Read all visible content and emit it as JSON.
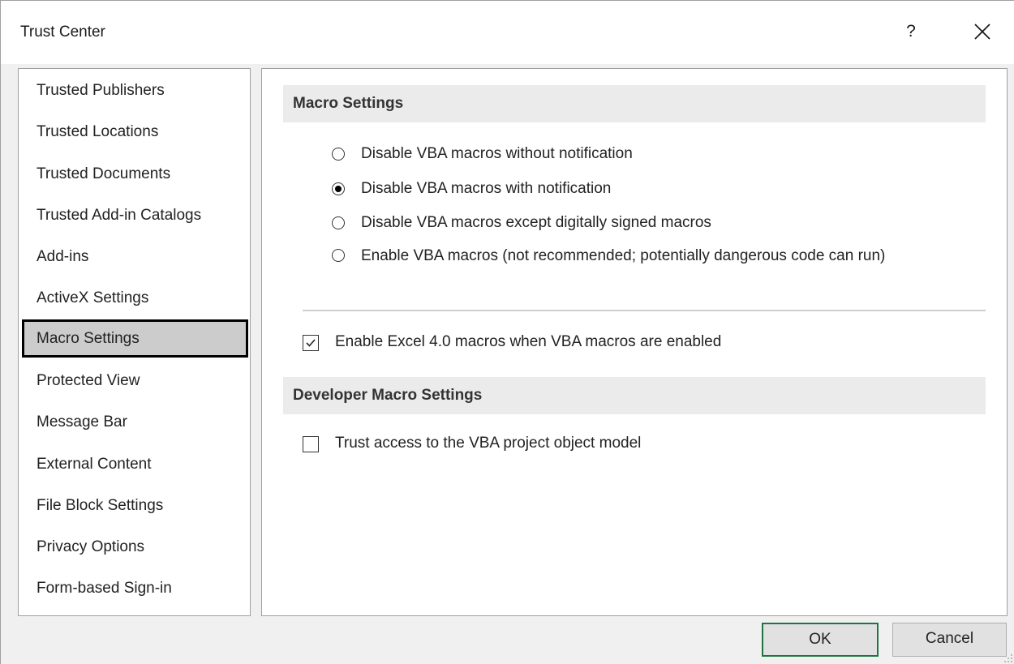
{
  "window": {
    "title": "Trust Center",
    "help_label": "?"
  },
  "sidebar": {
    "items": [
      {
        "label": "Trusted Publishers"
      },
      {
        "label": "Trusted Locations"
      },
      {
        "label": "Trusted Documents"
      },
      {
        "label": "Trusted Add-in Catalogs"
      },
      {
        "label": "Add-ins"
      },
      {
        "label": "ActiveX Settings"
      },
      {
        "label": "Macro Settings",
        "selected": true
      },
      {
        "label": "Protected View"
      },
      {
        "label": "Message Bar"
      },
      {
        "label": "External Content"
      },
      {
        "label": "File Block Settings"
      },
      {
        "label": "Privacy Options"
      },
      {
        "label": "Form-based Sign-in"
      }
    ]
  },
  "macro_settings": {
    "header": "Macro Settings",
    "selected_option": 1,
    "options": [
      {
        "label": "Disable VBA macros without notification"
      },
      {
        "label": "Disable VBA macros with notification"
      },
      {
        "label": "Disable VBA macros except digitally signed macros"
      },
      {
        "label": "Enable VBA macros (not recommended; potentially dangerous code can run)"
      }
    ],
    "excel4_checkbox": {
      "label": "Enable Excel 4.0 macros when VBA macros are enabled",
      "checked": true
    }
  },
  "developer_settings": {
    "header": "Developer Macro Settings",
    "vba_trust_checkbox": {
      "label": "Trust access to the VBA project object model",
      "checked": false
    }
  },
  "buttons": {
    "ok": "OK",
    "cancel": "Cancel"
  },
  "colors": {
    "ok_border": "#217346",
    "selected_item_bg": "#cccccc",
    "header_bg": "#ebebeb"
  }
}
